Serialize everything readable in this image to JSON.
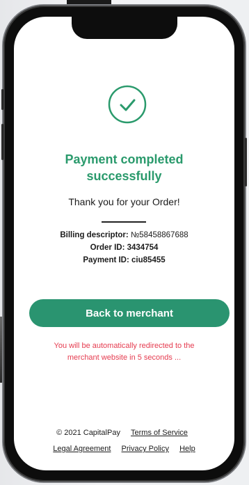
{
  "status": {
    "title_line1": "Payment completed",
    "title_line2": "successfully",
    "thanks": "Thank you for your Order!"
  },
  "details": {
    "billing_label": "Billing descriptor:",
    "billing_value": "№58458867688",
    "order_label": "Order ID:",
    "order_value": "3434754",
    "payment_label": "Payment ID:",
    "payment_value": "ciu85455"
  },
  "actions": {
    "back_label": "Back to merchant"
  },
  "redirect": {
    "line1": "You will be automatically redirected to the",
    "line2": "merchant website in 5 seconds ..."
  },
  "footer": {
    "copyright": "© 2021 CapitalPay",
    "terms": "Terms of Service",
    "legal": "Legal Agreement",
    "privacy": "Privacy Policy",
    "help": "Help"
  },
  "colors": {
    "accent": "#2a9a6c",
    "button": "#2a9470",
    "warning": "#e53b4f"
  },
  "icons": {
    "success": "check-circle-icon"
  }
}
